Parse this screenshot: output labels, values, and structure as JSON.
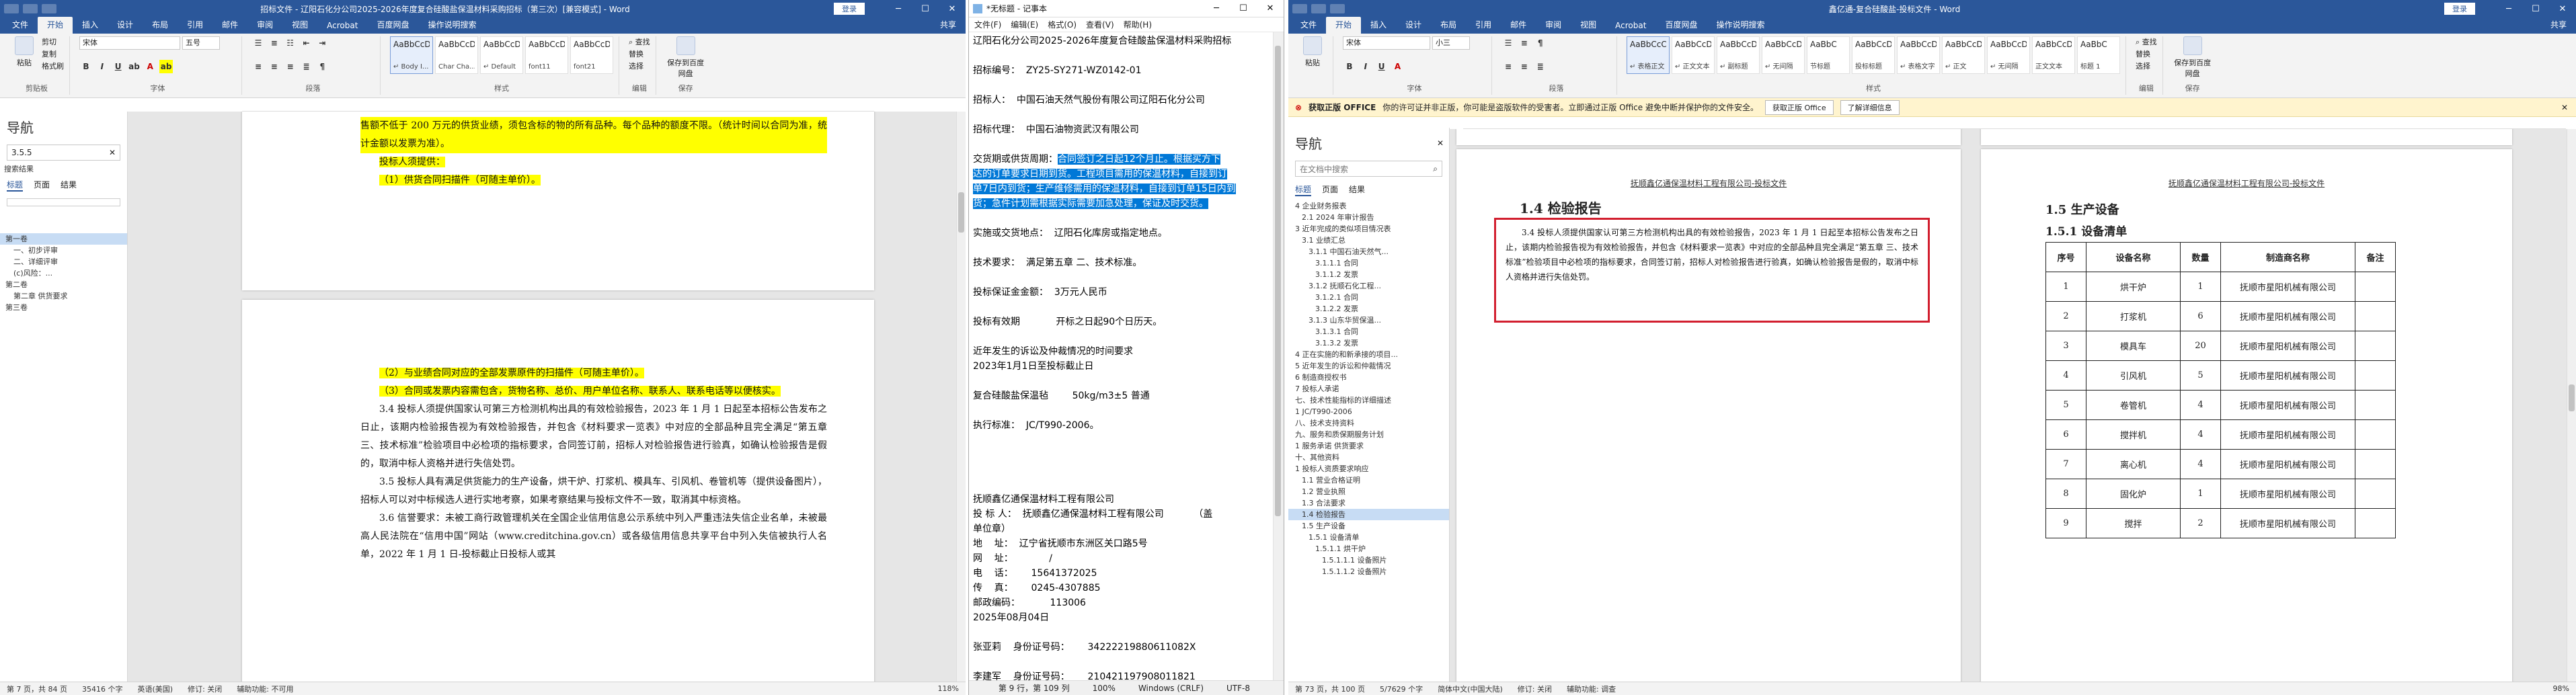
{
  "left_word": {
    "title": "招标文件 - 辽阳石化分公司2025-2026年度复合硅酸盐保温材料采购招标（第三次）[兼容模式] - Word",
    "signin": "登录",
    "share": "共享",
    "tabs": [
      "文件",
      "开始",
      "插入",
      "设计",
      "布局",
      "引用",
      "邮件",
      "审阅",
      "视图",
      "Acrobat",
      "百度网盘",
      "操作说明搜索"
    ],
    "active_tab": "开始",
    "ribbon": {
      "paste": "粘贴",
      "cut": "剪切",
      "copy": "复制",
      "format_painter": "格式刷",
      "clipboard": "剪贴板",
      "font_name": "宋体",
      "font_size": "五号",
      "font_group": "字体",
      "para_group": "段落",
      "styles_group": "样式",
      "edit_group": "编辑",
      "find": "查找",
      "replace": "替换",
      "select": "选择",
      "save_baidu": "保存到百度网盘",
      "save_group": "保存",
      "styles": [
        {
          "sample": "AaBbCcDd",
          "name": "↵ Body I..."
        },
        {
          "sample": "AaBbCcDd",
          "name": "Char Cha..."
        },
        {
          "sample": "AaBbCcDd",
          "name": "↵ Default"
        },
        {
          "sample": "AaBbCcDd",
          "name": "font11"
        },
        {
          "sample": "AaBbCcDd",
          "name": "font21"
        }
      ]
    },
    "nav": {
      "title": "导航",
      "search": "3.5.5",
      "results_label": "搜索结果",
      "tabs": [
        "标题",
        "页面",
        "结果"
      ],
      "items": [
        "第一卷",
        "一、初步评审",
        "二、详细评审",
        "(c)风险：...",
        "第二卷",
        "第二章 供货要求",
        "第三卷"
      ]
    },
    "page1": {
      "lines": [
        {
          "text": "售额不低于 200 万元的供货业绩，须包含标的物的所有品种。每个品种的额度不限。（统计时间以合同为准，统计金额以发票为准）。",
          "hl": true
        },
        {
          "text": "投标人须提供：",
          "hl": true
        },
        {
          "text": "（1）供货合同扫描件（可随主单价）。",
          "hl": true
        }
      ]
    },
    "page2": {
      "hl_lines": [
        "（2）与业绩合同对应的全部发票原件的扫描件（可随主单价）。",
        "（3）合同或发票内容需包含，货物名称、总价、用户单位名称、联系人、联系电话等以便核实。"
      ],
      "paras": [
        "3.4 投标人须提供国家认可第三方检测机构出具的有效检验报告，2023 年 1 月 1 日起至本招标公告发布之日止，该期内检验报告视为有效检验报告，并包含《材料要求一览表》中对应的全部品种且完全满足“第五章 三、技术标准”检验项目中必检项的指标要求，合同签订前，招标人对检验报告进行验真，如确认检验报告是假的，取消中标人资格并进行失信处罚。",
        "3.5 投标人具有满足供货能力的生产设备，烘干炉、打浆机、模具车、引风机、卷管机等（提供设备图片），招标人可以对中标候选人进行实地考察，如果考察结果与投标文件不一致，取消其中标资格。",
        "3.6 信誉要求：未被工商行政管理机关在全国企业信用信息公示系统中列入严重违法失信企业名单，未被最高人民法院在“信用中国”网站（www.creditchina.gov.cn）或各级信用信息共享平台中列入失信被执行人名单，2022 年 1 月 1 日-投标截止日投标人或其"
      ]
    },
    "status": {
      "page": "第 7 页，共 84 页",
      "words": "35416 个字",
      "lang": "英语(美国)",
      "track": "修订: 关闭",
      "access": "辅助功能: 不可用",
      "zoom": "118%"
    }
  },
  "notepad": {
    "title": "*无标题 - 记事本",
    "menus": [
      "文件(F)",
      "编辑(E)",
      "格式(O)",
      "查看(V)",
      "帮助(H)"
    ],
    "lines": [
      {
        "t": "辽阳石化分公司2025-2026年度复合硅酸盐保温材料采购招标"
      },
      {
        "t": ""
      },
      {
        "t": "招标编号：  ZY25-SY271-WZ0142-01"
      },
      {
        "t": ""
      },
      {
        "t": "招标人：  中国石油天然气股份有限公司辽阳石化分公司"
      },
      {
        "t": ""
      },
      {
        "t": "招标代理：  中国石油物资武汉有限公司"
      },
      {
        "t": ""
      },
      {
        "t": "交货期或供货周期：",
        "sel": "合同签订之日起12个月止。根据买方下"
      },
      {
        "t": "",
        "sel": "达的订单要求日期到货。工程项目需用的保温材料，自接到订"
      },
      {
        "t": "",
        "sel": "单7日内到货；生产维修需用的保温材料，自接到订单15日内到"
      },
      {
        "t": "",
        "sel": "货；急件计划需根据实际需要加急处理，保证及时交货。"
      },
      {
        "t": ""
      },
      {
        "t": "实施或交货地点：  辽阳石化库房或指定地点。"
      },
      {
        "t": ""
      },
      {
        "t": "技术要求：  满足第五章 二、技术标准。"
      },
      {
        "t": ""
      },
      {
        "t": "投标保证金金额：  3万元人民币"
      },
      {
        "t": ""
      },
      {
        "t": "投标有效期            开标之日起90个日历天。"
      },
      {
        "t": ""
      },
      {
        "t": "近年发生的诉讼及仲裁情况的时间要求"
      },
      {
        "t": "2023年1月1日至投标截止日"
      },
      {
        "t": ""
      },
      {
        "t": "复合硅酸盐保温毡        50kg/m3±5 普通"
      },
      {
        "t": ""
      },
      {
        "t": "执行标准：  JC/T990-2006。"
      },
      {
        "t": ""
      },
      {
        "t": ""
      },
      {
        "t": ""
      },
      {
        "t": ""
      },
      {
        "t": "抚顺鑫亿通保温材料工程有限公司"
      },
      {
        "t": "投 标 人：  抚顺鑫亿通保温材料工程有限公司          （盖"
      },
      {
        "t": "单位章）"
      },
      {
        "t": "地    址：  辽宁省抚顺市东洲区关口路5号"
      },
      {
        "t": "网    址：            /"
      },
      {
        "t": "电    话：      15641372025"
      },
      {
        "t": "传    真：      0245-4307885"
      },
      {
        "t": "邮政编码：          113006"
      },
      {
        "t": "2025年08月04日"
      },
      {
        "t": ""
      },
      {
        "t": "张亚莉    身份证号码：      34222219880611082X"
      },
      {
        "t": ""
      },
      {
        "t": "李建军    身份证号码：      210421197908011821"
      }
    ],
    "status": {
      "pos": "第 9 行，第 109 列",
      "zoom": "100%",
      "eol": "Windows (CRLF)",
      "enc": "UTF-8"
    }
  },
  "right_word": {
    "title": "鑫亿通-复合硅酸盐-投标文件 - Word",
    "signin": "登录",
    "share": "共享",
    "tabs": [
      "文件",
      "开始",
      "插入",
      "设计",
      "布局",
      "引用",
      "邮件",
      "审阅",
      "视图",
      "Acrobat",
      "百度网盘",
      "操作说明搜索"
    ],
    "active_tab": "开始",
    "ribbon": {
      "paste": "粘贴",
      "font_name": "宋体",
      "font_size": "小三",
      "font_group": "字体",
      "para_group": "段落",
      "styles_group": "样式",
      "edit_group": "编辑",
      "find": "查找",
      "replace": "替换",
      "select": "选择",
      "save_baidu": "保存到百度网盘",
      "save_group": "保存",
      "styles": [
        {
          "sample": "AaBbCcC",
          "name": "↵ 表格正文"
        },
        {
          "sample": "AaBbCcDc",
          "name": "↵ 正文文本"
        },
        {
          "sample": "AaBbCcDc",
          "name": "↵ 副标题"
        },
        {
          "sample": "AaBbCcDd",
          "name": "↵ 无间隔"
        },
        {
          "sample": "AaBbC",
          "name": "节标题"
        },
        {
          "sample": "AaBbCcD",
          "name": "投标标题"
        },
        {
          "sample": "AaBbCcD",
          "name": "↵ 表格文字"
        },
        {
          "sample": "AaBbCcDd",
          "name": "↵ 正文"
        },
        {
          "sample": "AaBbCcDd",
          "name": "↵ 无间隔"
        },
        {
          "sample": "AaBbCcDd",
          "name": "正文文本"
        },
        {
          "sample": "AaBbC",
          "name": "标题 1"
        }
      ]
    },
    "banner": {
      "label": "获取正版 OFFICE",
      "text": "你的许可证并非正版，你可能是盗版软件的受害者。立即通过正版 Office 避免中断并保护你的文件安全。",
      "btn1": "获取正版 Office",
      "btn2": "了解详细信息"
    },
    "nav": {
      "title": "导航",
      "search_placeholder": "在文档中搜索",
      "tabs": [
        "标题",
        "页面",
        "结果"
      ],
      "items": [
        "4 企业财务报表",
        "2.1 2024 年审计报告",
        "3 近年完成的类似项目情况表",
        "3.1 业绩汇总",
        "3.1.1 中国石油天然气...",
        "3.1.1.1 合同",
        "3.1.1.2 发票",
        "3.1.2 抚顺石化工程...",
        "3.1.2.1 合同",
        "3.1.2.2 发票",
        "3.1.3 山东华贸保温...",
        "3.1.3.1 合同",
        "3.1.3.2 发票",
        "4 正在实施的和新承接的项目...",
        "5 近年发生的诉讼和仲裁情况",
        "6 制造商授权书",
        "7 投标人承诺",
        "七、技术性能指标的详细描述",
        "1 JC/T990-2006",
        "八、技术支持资料",
        "九、服务和质保期服务计划",
        "1 服务承诺 供货要求",
        "十、其他资料",
        "1 投标人资质要求响应",
        "1.1 营业合格证明",
        "1.2 营业执照",
        "1.3 合法要求",
        "1.4 检验报告",
        "1.5 生产设备",
        "1.5.1 设备清单",
        "1.5.1.1 烘干炉",
        "1.5.1.1.1 设备照片",
        "1.5.1.1.2 设备照片"
      ],
      "highlight_index": 27
    },
    "left_page": {
      "header": "抚顺鑫亿通保温材料工程有限公司-投标文件",
      "heading": "1.4  检验报告",
      "body": "3.4 投标人须提供国家认可第三方检测机构出具的有效检验报告，2023 年 1 月 1 日起至本招标公告发布之日止，该期内检验报告视为有效检验报告，并包含《材料要求一览表》中对应的全部品种且完全满足“第五章 三、技术标准”检验项目中必检项的指标要求，合同签订前，招标人对检验报告进行验真，如确认检验报告是假的，取消中标人资格并进行失信处罚。"
    },
    "right_page": {
      "header": "抚顺鑫亿通保温材料工程有限公司-投标文件",
      "h1": "1.5  生产设备",
      "h2": "1.5.1  设备清单",
      "table_head": [
        "序号",
        "设备名称",
        "数量",
        "制造商名称",
        "备注"
      ],
      "rows": [
        [
          "1",
          "烘干炉",
          "1",
          "抚顺市星阳机械有限公司",
          ""
        ],
        [
          "2",
          "打浆机",
          "6",
          "抚顺市星阳机械有限公司",
          ""
        ],
        [
          "3",
          "模具车",
          "20",
          "抚顺市星阳机械有限公司",
          ""
        ],
        [
          "4",
          "引风机",
          "5",
          "抚顺市星阳机械有限公司",
          ""
        ],
        [
          "5",
          "卷管机",
          "4",
          "抚顺市星阳机械有限公司",
          ""
        ],
        [
          "6",
          "搅拌机",
          "4",
          "抚顺市星阳机械有限公司",
          ""
        ],
        [
          "7",
          "离心机",
          "4",
          "抚顺市星阳机械有限公司",
          ""
        ],
        [
          "8",
          "固化炉",
          "1",
          "抚顺市星阳机械有限公司",
          ""
        ],
        [
          "9",
          "搅拌",
          "2",
          "抚顺市星阳机械有限公司",
          ""
        ]
      ]
    },
    "status": {
      "page": "第 73 页，共 100 页",
      "words": "5/7629 个字",
      "lang": "简体中文(中国大陆)",
      "track": "修订: 关闭",
      "access": "辅助功能: 调查",
      "zoom": "98%"
    }
  }
}
